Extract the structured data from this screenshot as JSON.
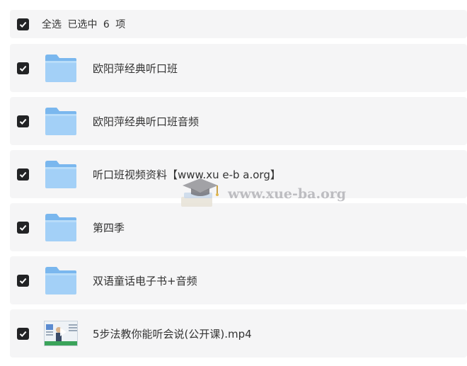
{
  "header": {
    "select_all": "全选",
    "selected_prefix": "已选中",
    "selected_count": "6",
    "selected_suffix": "项",
    "checked": true
  },
  "items": [
    {
      "name": "欧阳萍经典听口班",
      "type": "folder",
      "checked": true
    },
    {
      "name": "欧阳萍经典听口班音频",
      "type": "folder",
      "checked": true
    },
    {
      "name": "听口班视频资料【www.xu e-b a.org】",
      "type": "folder",
      "checked": true
    },
    {
      "name": "第四季",
      "type": "folder",
      "checked": true
    },
    {
      "name": "双语童话电子书+音频",
      "type": "folder",
      "checked": true
    },
    {
      "name": "5步法教你能听会说(公开课).mp4",
      "type": "video",
      "checked": true
    }
  ],
  "watermark": {
    "text": "www.xue-ba.org"
  },
  "colors": {
    "row_bg": "#f5f5f6",
    "checkbox": "#222325",
    "folder_light": "#a3d0f7",
    "folder_dark": "#7ab7ee"
  }
}
